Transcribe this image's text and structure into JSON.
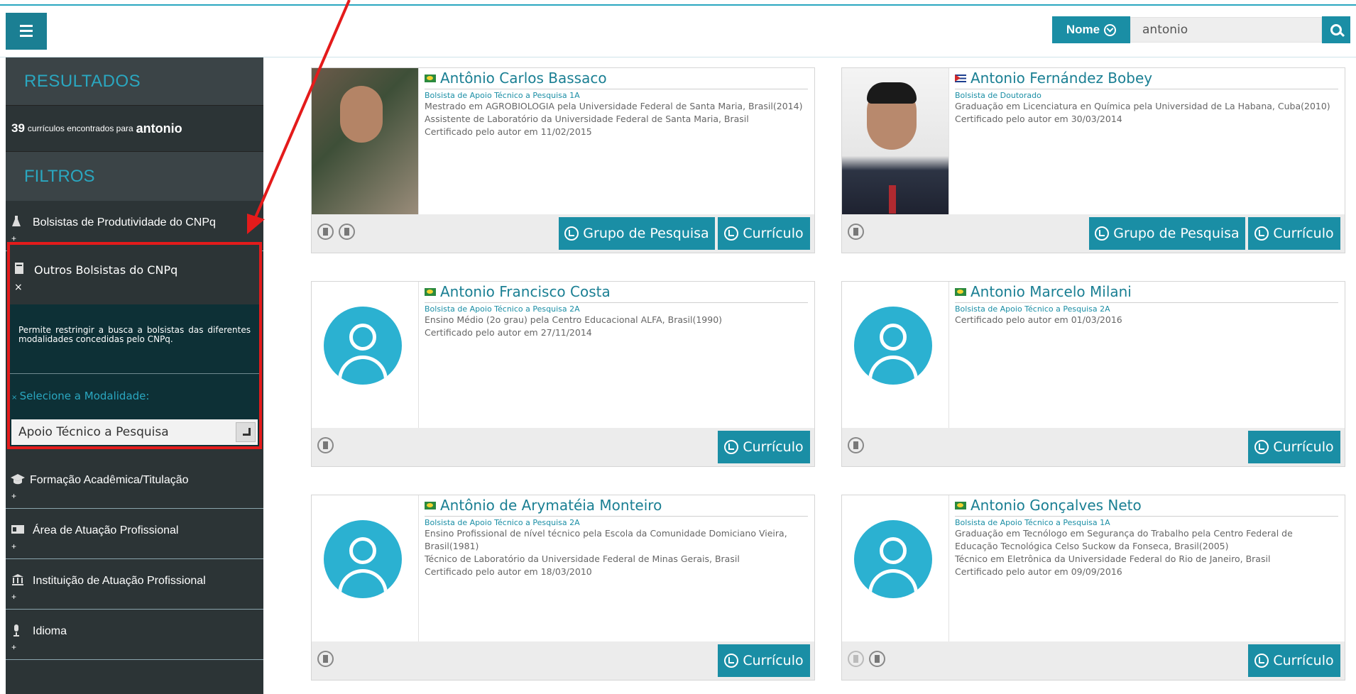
{
  "header": {
    "search_mode": "Nome",
    "search_value": "antonio"
  },
  "sidebar": {
    "resultados_title": "RESULTADOS",
    "result_count": "39",
    "result_text": "currículos encontrados para",
    "result_term": "antonio",
    "filtros_title": "FILTROS",
    "filters": [
      {
        "label": "Bolsistas de Produtividade do CNPq",
        "toggle": "+"
      },
      {
        "label": "Outros Bolsistas do CNPq",
        "toggle": "×"
      },
      {
        "label": "Formação Acadêmica/Titulação",
        "toggle": "+"
      },
      {
        "label": "Área de Atuação Profissional",
        "toggle": "+"
      },
      {
        "label": "Instituição de Atuação Profissional",
        "toggle": "+"
      },
      {
        "label": "Idioma",
        "toggle": "+"
      }
    ],
    "outros": {
      "description": "Permite restringir a busca a bolsistas das diferentes modalidades concedidas pelo CNPq.",
      "modalidade_label": "Selecione a Modalidade:",
      "modalidade_value": "Apoio Técnico a Pesquisa"
    }
  },
  "results": [
    {
      "name": "Antônio Carlos Bassaco",
      "flag": "br",
      "role": "Bolsista de Apoio Técnico a Pesquisa 1A",
      "lines": [
        "Mestrado em AGROBIOLOGIA pela Universidade Federal de Santa Maria, Brasil(2014)",
        "Assistente de Laboratório da Universidade Federal de Santa Maria, Brasil",
        "Certificado pelo autor em 11/02/2015"
      ],
      "photo": "photo",
      "grupo_label": "Grupo de Pesquisa",
      "curriculo_label": "Currículo"
    },
    {
      "name": "Antonio Fernández Bobey",
      "flag": "cu",
      "role": "Bolsista de Doutorado",
      "lines": [
        "Graduação em Licenciatura en Química pela Universidad de La Habana, Cuba(2010)",
        "Certificado pelo autor em 30/03/2014"
      ],
      "photo": "photo",
      "grupo_label": "Grupo de Pesquisa",
      "curriculo_label": "Currículo"
    },
    {
      "name": "Antonio Francisco Costa",
      "flag": "br",
      "role": "Bolsista de Apoio Técnico a Pesquisa 2A",
      "lines": [
        "Ensino Médio (2o grau) pela Centro Educacional ALFA, Brasil(1990)",
        "Certificado pelo autor em 27/11/2014"
      ],
      "photo": "avatar",
      "curriculo_label": "Currículo"
    },
    {
      "name": "Antonio Marcelo Milani",
      "flag": "br",
      "role": "Bolsista de Apoio Técnico a Pesquisa 2A",
      "lines": [
        "Certificado pelo autor em 01/03/2016"
      ],
      "photo": "avatar",
      "curriculo_label": "Currículo"
    },
    {
      "name": "Antônio de Arymatéia Monteiro",
      "flag": "br",
      "role": "Bolsista de Apoio Técnico a Pesquisa 2A",
      "lines": [
        "Ensino Profissional de nível técnico pela Escola da Comunidade Domiciano Vieira, Brasil(1981)",
        "Técnico de Laboratório da Universidade Federal de Minas Gerais, Brasil",
        "Certificado pelo autor em 18/03/2010"
      ],
      "photo": "avatar",
      "curriculo_label": "Currículo"
    },
    {
      "name": "Antonio Gonçalves Neto",
      "flag": "br",
      "role": "Bolsista de Apoio Técnico a Pesquisa 1A",
      "lines": [
        "Graduação em Tecnólogo em Segurança do Trabalho pela Centro Federal de Educação Tecnológica Celso Suckow da Fonseca, Brasil(2005)",
        "Técnico em Eletrônica da Universidade Federal do Rio de Janeiro, Brasil",
        "Certificado pelo autor em 09/09/2016"
      ],
      "photo": "avatar",
      "curriculo_label": "Currículo"
    }
  ],
  "colors": {
    "accent": "#1a8ea5",
    "sidebar": "#2c3436",
    "highlight": "#e41b1b"
  }
}
